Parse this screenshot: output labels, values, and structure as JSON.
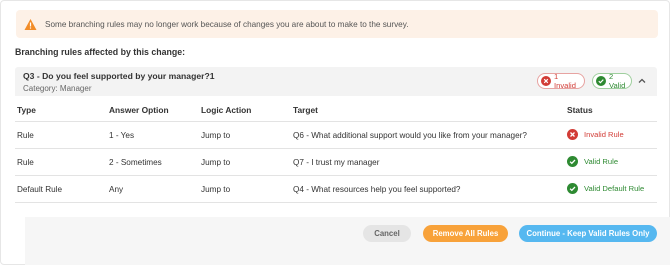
{
  "warning": {
    "icon": "warning-triangle-icon",
    "text": "Some branching rules may no longer work because of changes you are about to make to the survey."
  },
  "section_title": "Branching rules affected by this change:",
  "question": {
    "title": "Q3 - Do you feel supported by your manager?1",
    "category": "Category: Manager",
    "invalid_badge": "1 Invalid",
    "valid_badge": "2 Valid",
    "collapse_icon": "chevron-up-icon"
  },
  "table": {
    "headers": {
      "type": "Type",
      "answer": "Answer Option",
      "action": "Logic Action",
      "target": "Target",
      "status": "Status"
    },
    "rows": [
      {
        "type": "Rule",
        "answer": "1 - Yes",
        "action": "Jump to",
        "target": "Q6 - What additional support would you like from your manager?",
        "status": "Invalid Rule",
        "status_kind": "invalid"
      },
      {
        "type": "Rule",
        "answer": "2 - Sometimes",
        "action": "Jump to",
        "target": "Q7 - I trust my manager",
        "status": "Valid Rule",
        "status_kind": "valid"
      },
      {
        "type": "Default Rule",
        "answer": "Any",
        "action": "Jump to",
        "target": "Q4 - What resources help you feel supported?",
        "status": "Valid Default Rule",
        "status_kind": "valid"
      }
    ]
  },
  "buttons": {
    "cancel": "Cancel",
    "remove_all": "Remove All Rules",
    "keep_valid": "Continue - Keep Valid Rules Only"
  },
  "colors": {
    "warning_bg": "#fdf1e7",
    "warning_icon": "#f28c28",
    "invalid": "#d23c36",
    "valid": "#2e8a32",
    "remove_button": "#f8a23a",
    "keep_button": "#56b8f0"
  }
}
